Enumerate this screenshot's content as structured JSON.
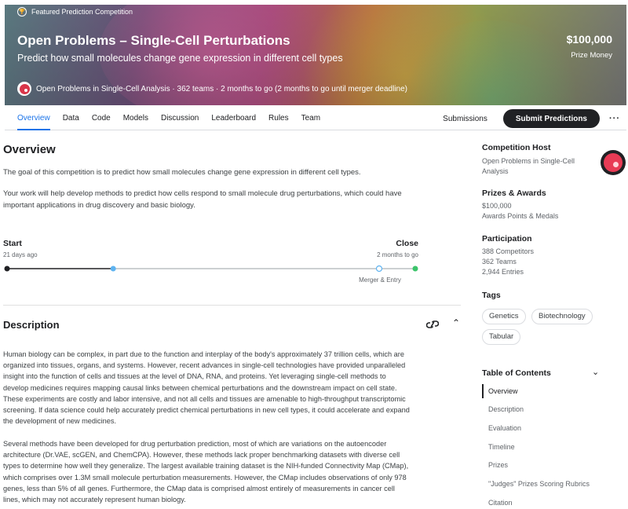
{
  "banner": {
    "featured_label": "Featured Prediction Competition",
    "title": "Open Problems – Single-Cell Perturbations",
    "subtitle": "Predict how small molecules change gene expression in different cell types",
    "prize_amount": "$100,000",
    "prize_label": "Prize Money",
    "host_line": "Open Problems in Single-Cell Analysis · 362 teams · 2 months to go (2 months to go until merger deadline)"
  },
  "tabs": [
    "Overview",
    "Data",
    "Code",
    "Models",
    "Discussion",
    "Leaderboard",
    "Rules",
    "Team"
  ],
  "actions": {
    "submissions": "Submissions",
    "submit": "Submit Predictions",
    "more": "···"
  },
  "overview": {
    "heading": "Overview",
    "p1": "The goal of this competition is to predict how small molecules change gene expression in different cell types.",
    "p2": "Your work will help develop methods to predict how cells respond to small molecule drug perturbations, which could have important applications in drug discovery and basic biology."
  },
  "timeline": {
    "start_label": "Start",
    "start_sub": "21 days ago",
    "close_label": "Close",
    "close_sub": "2 months to go",
    "merger_label": "Merger & Entry",
    "progress": 0.26
  },
  "description": {
    "heading": "Description",
    "p1": "Human biology can be complex, in part due to the function and interplay of the body's approximately 37 trillion cells, which are organized into tissues, organs, and systems. However, recent advances in single-cell technologies have provided unparalleled insight into the function of cells and tissues at the level of DNA, RNA, and proteins. Yet leveraging single-cell methods to develop medicines requires mapping causal links between chemical perturbations and the downstream impact on cell state. These experiments are costly and labor intensive, and not all cells and tissues are amenable to high-throughput transcriptomic screening. If data science could help accurately predict chemical perturbations in new cell types, it could accelerate and expand the development of new medicines.",
    "p2": "Several methods have been developed for drug perturbation prediction, most of which are variations on the autoencoder architecture (Dr.VAE, scGEN, and ChemCPA). However, these methods lack proper benchmarking datasets with diverse cell types to determine how well they generalize. The largest available training dataset is the NIH-funded Connectivity Map (CMap), which comprises over 1.3M small molecule perturbation measurements. However, the CMap includes observations of only 978 genes, less than 5% of all genes. Furthermore, the CMap data is comprised almost entirely of measurements in cancer cell lines, which may not accurately represent human biology."
  },
  "sidebar": {
    "host_heading": "Competition Host",
    "host_name": "Open Problems in Single-Cell Analysis",
    "prizes_heading": "Prizes & Awards",
    "prize_amount": "$100,000",
    "prize_extra": "Awards Points & Medals",
    "participation_heading": "Participation",
    "competitors": "388 Competitors",
    "teams": "362 Teams",
    "entries": "2,944 Entries",
    "tags_heading": "Tags",
    "tags": [
      "Genetics",
      "Biotechnology",
      "Tabular"
    ],
    "toc_heading": "Table of Contents",
    "toc": [
      "Overview",
      "Description",
      "Evaluation",
      "Timeline",
      "Prizes",
      "\"Judges\" Prizes Scoring Rubrics",
      "Citation"
    ]
  },
  "colors": {
    "accent": "#1a73e8",
    "dark": "#202124",
    "timeline_done": "#202124",
    "timeline_marker": "#5eb3f0",
    "timeline_end": "#3cc46b"
  }
}
